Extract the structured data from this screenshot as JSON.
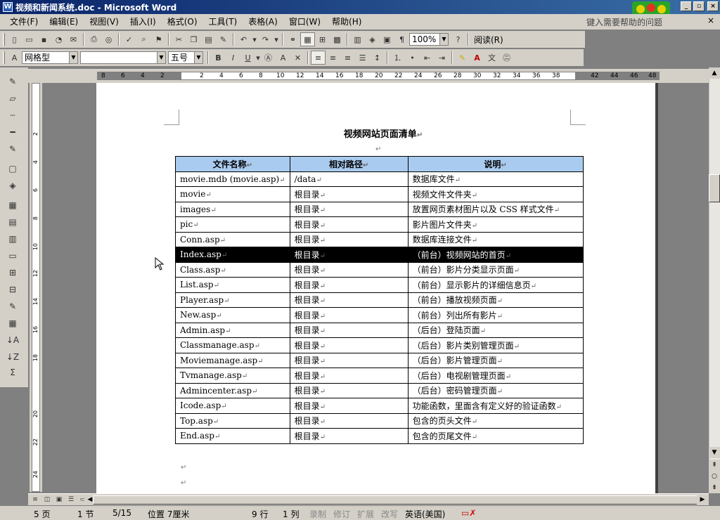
{
  "window": {
    "title": "视频和新闻系统.doc - Microsoft Word",
    "min": "_",
    "max": "▫",
    "close": "×"
  },
  "menu": {
    "items": [
      "文件(F)",
      "编辑(E)",
      "视图(V)",
      "插入(I)",
      "格式(O)",
      "工具(T)",
      "表格(A)",
      "窗口(W)",
      "帮助(H)"
    ],
    "help_placeholder": "键入需要帮助的问题",
    "close": "×"
  },
  "toolbar1": {
    "zoom": "100%",
    "read": "阅读(R)"
  },
  "toolbar2": {
    "style": "网格型",
    "font": "",
    "size": "五号",
    "bold": "B",
    "italic": "I",
    "underline": "U"
  },
  "ruler": {
    "h_ticks": [
      "8",
      "6",
      "4",
      "2",
      "2",
      "4",
      "6",
      "8",
      "10",
      "12",
      "14",
      "16",
      "18",
      "20",
      "22",
      "24",
      "26",
      "28",
      "30",
      "32",
      "34",
      "36",
      "38",
      "42",
      "44",
      "46",
      "48"
    ],
    "v_ticks": [
      "2",
      "4",
      "6",
      "8",
      "10",
      "12",
      "14",
      "16",
      "18",
      "20",
      "22",
      "24"
    ]
  },
  "document": {
    "title": "视频网站页面清单",
    "headers": [
      "文件名称",
      "相对路径",
      "说明"
    ],
    "rows": [
      [
        "movie.mdb (movie.asp)",
        "/data",
        "数据库文件"
      ],
      [
        "movie",
        "根目录",
        "视频文件文件夹"
      ],
      [
        "images",
        "根目录",
        "放置网页素材图片以及 CSS 样式文件"
      ],
      [
        "pic",
        "根目录",
        "影片图片文件夹"
      ],
      [
        "Conn.asp",
        "根目录",
        "数据库连接文件"
      ],
      [
        "Index.asp",
        "根目录",
        "（前台）视频网站的首页"
      ],
      [
        "Class.asp",
        "根目录",
        "（前台）影片分类显示页面"
      ],
      [
        "List.asp",
        "根目录",
        "（前台）显示影片的详细信息页"
      ],
      [
        "Player.asp",
        "根目录",
        "（前台）播放视频页面"
      ],
      [
        "New.asp",
        "根目录",
        "（前台）列出所有影片"
      ],
      [
        "Admin.asp",
        "根目录",
        "（后台）登陆页面"
      ],
      [
        "Classmanage.asp",
        "根目录",
        "（后台）影片类别管理页面"
      ],
      [
        "Moviemanage.asp",
        "根目录",
        "（后台）影片管理页面"
      ],
      [
        "Tvmanage.asp",
        "根目录",
        "（后台）电视剧管理页面"
      ],
      [
        "Admincenter.asp",
        "根目录",
        "（后台）密码管理页面"
      ],
      [
        "Icode.asp",
        "根目录",
        "功能函数，里面含有定义好的验证函数"
      ],
      [
        "Top.asp",
        "根目录",
        "包含的页头文件"
      ],
      [
        "End.asp",
        "根目录",
        "包含的页尾文件"
      ]
    ],
    "selected_row": 5
  },
  "status": {
    "page": "5 页",
    "section": "1 节",
    "pages": "5/15",
    "position": "位置 7厘米",
    "line": "9 行",
    "column": "1 列",
    "rec": "录制",
    "trk": "修订",
    "ext": "扩展",
    "ovr": "改写",
    "lang": "英语(美国)"
  }
}
